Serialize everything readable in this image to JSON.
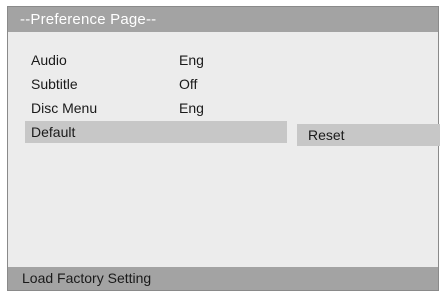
{
  "header": {
    "title": "--Preference Page--"
  },
  "menu": {
    "items": [
      {
        "label": "Audio",
        "value": "Eng"
      },
      {
        "label": "Subtitle",
        "value": "Off"
      },
      {
        "label": "Disc Menu",
        "value": "Eng"
      },
      {
        "label": "Default",
        "value": ""
      }
    ],
    "selected_index": 3
  },
  "option_box": {
    "label": "Reset"
  },
  "footer": {
    "text": "Load Factory Setting"
  },
  "colors": {
    "header_bg": "#a3a3a3",
    "panel_bg": "#ececec",
    "highlight_bg": "#c7c7c7",
    "header_text": "#ffffff",
    "text": "#1a1a1a"
  }
}
